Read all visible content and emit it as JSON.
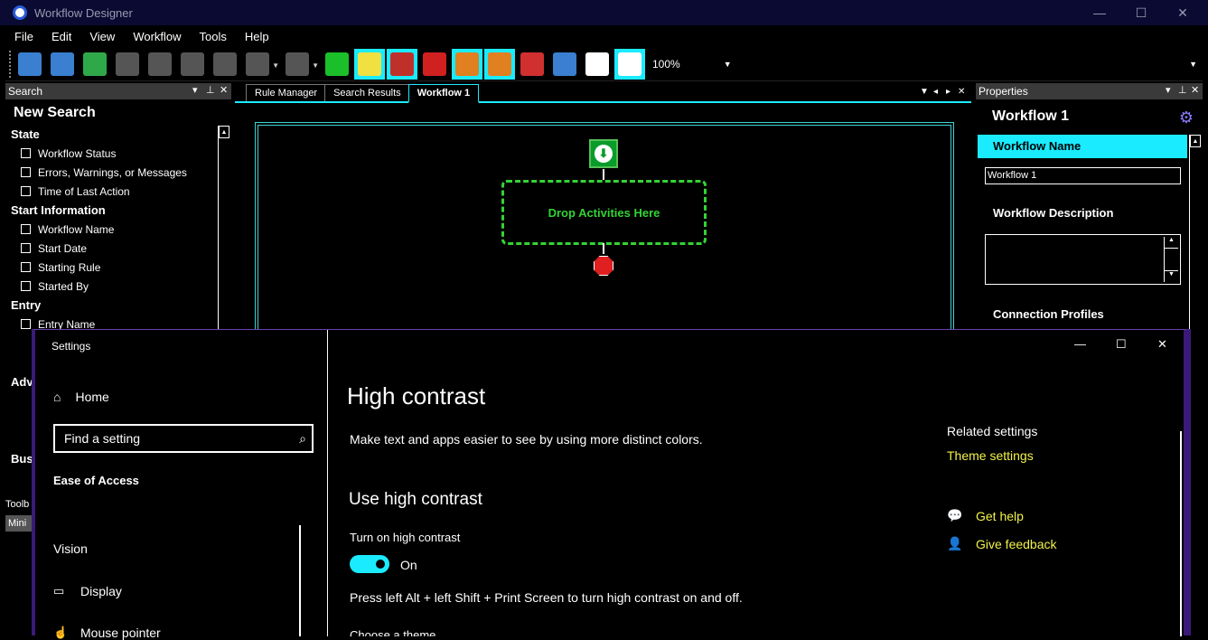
{
  "app": {
    "title": "Workflow Designer"
  },
  "menu": [
    "File",
    "Edit",
    "View",
    "Workflow",
    "Tools",
    "Help"
  ],
  "toolbar": {
    "zoom": "100%",
    "buttons": [
      {
        "name": "new-workflow-icon",
        "color": "#3a7fd0"
      },
      {
        "name": "open-workflow-icon",
        "color": "#3a7fd0"
      },
      {
        "name": "export-workflow-icon",
        "color": "#2fa84a"
      },
      {
        "name": "cut-icon",
        "color": "#555555"
      },
      {
        "name": "copy-icon",
        "color": "#555555"
      },
      {
        "name": "paste-icon",
        "color": "#555555"
      },
      {
        "name": "delete-icon",
        "color": "#555555"
      },
      {
        "name": "undo-icon",
        "color": "#555555"
      },
      {
        "name": "redo-icon",
        "color": "#555555"
      },
      {
        "name": "run-icon",
        "color": "#1bbf2a"
      },
      {
        "name": "find-icon",
        "color": "#f0e040"
      },
      {
        "name": "tools-icon",
        "color": "#c0302a"
      },
      {
        "name": "stop-icon",
        "color": "#d02020"
      },
      {
        "name": "rules-icon",
        "color": "#e08020"
      },
      {
        "name": "checklist-icon",
        "color": "#e08020"
      },
      {
        "name": "report-icon",
        "color": "#d03030"
      },
      {
        "name": "settings-icon",
        "color": "#3a7fd0"
      },
      {
        "name": "pan-hand-icon",
        "color": "#ffffff"
      },
      {
        "name": "select-pointer-icon",
        "color": "#ffffff"
      }
    ]
  },
  "search_pane": {
    "header": "Search",
    "title": "New Search",
    "sections": [
      {
        "label": "State",
        "items": [
          "Workflow Status",
          "Errors, Warnings, or Messages",
          "Time of Last Action"
        ]
      },
      {
        "label": "Start Information",
        "items": [
          "Workflow Name",
          "Start Date",
          "Starting Rule",
          "Started By"
        ]
      },
      {
        "label": "Entry",
        "items": [
          "Entry Name"
        ]
      }
    ],
    "partial": {
      "adv": "Adv",
      "bus": "Bus",
      "toolbox": "Toolb",
      "mini": "Mini"
    }
  },
  "tabs": [
    "Rule Manager",
    "Search Results",
    "Workflow 1"
  ],
  "designer": {
    "drop_label": "Drop Activities Here"
  },
  "properties": {
    "header": "Properties",
    "title": "Workflow 1",
    "selected": "Workflow Name",
    "name_value": "Workflow 1",
    "description_label": "Workflow Description",
    "profiles_label": "Connection Profiles"
  },
  "settings": {
    "title": "Settings",
    "nav": {
      "home": "Home",
      "search_placeholder": "Find a setting",
      "category": "Ease of Access",
      "group": "Vision",
      "items": [
        "Display",
        "Mouse pointer"
      ]
    },
    "main": {
      "title": "High contrast",
      "description": "Make text and apps easier to see by using more distinct colors.",
      "use_heading": "Use high contrast",
      "toggle_label": "Turn on high contrast",
      "toggle_state": "On",
      "shortcut": "Press left Alt + left Shift + Print Screen to turn high contrast on and off.",
      "choose_theme": "Choose a theme"
    },
    "related": {
      "heading": "Related settings",
      "theme_link": "Theme settings",
      "help": "Get help",
      "feedback": "Give feedback"
    }
  },
  "colors": {
    "accent": "#1aebff",
    "link": "#f2f24a",
    "start": "#0a9c2a",
    "drop": "#34d334",
    "end": "#e02020"
  }
}
